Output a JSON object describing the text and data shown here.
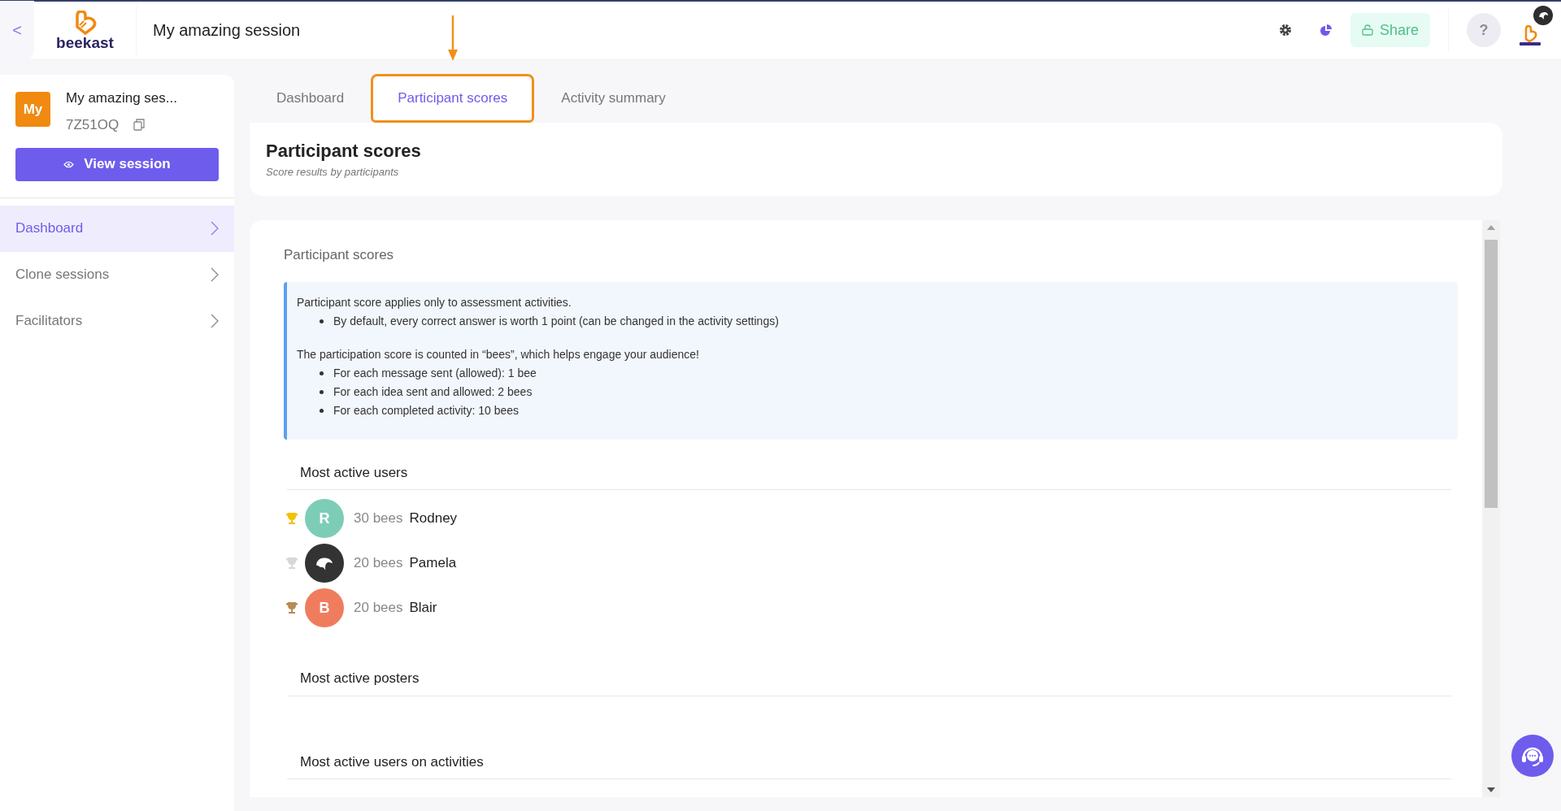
{
  "header": {
    "back": "<",
    "logo": "beekast",
    "title": "My amazing session",
    "share": "Share",
    "help": "?"
  },
  "sidebar": {
    "session": {
      "badge": "My",
      "name": "My amazing ses...",
      "code": "7Z51OQ",
      "view_button": "View session"
    },
    "items": [
      {
        "label": "Dashboard",
        "selected": true
      },
      {
        "label": "Clone sessions",
        "selected": false
      },
      {
        "label": "Facilitators",
        "selected": false
      }
    ]
  },
  "tabs": [
    {
      "label": "Dashboard",
      "selected": false,
      "highlighted": false
    },
    {
      "label": "Participant scores",
      "selected": true,
      "highlighted": true
    },
    {
      "label": "Activity summary",
      "selected": false,
      "highlighted": false
    }
  ],
  "page_header": {
    "title": "Participant scores",
    "subtitle": "Score results by participants"
  },
  "panel": {
    "title": "Participant scores",
    "info": [
      {
        "text": "Participant score applies only to assessment activities.",
        "bullets": [
          "By default, every correct answer is worth 1 point (can be changed in the activity settings)"
        ]
      },
      {
        "text": "The participation score is counted in “bees”, which helps engage your audience!",
        "bullets": [
          "For each message sent (allowed): 1 bee",
          "For each idea sent and allowed: 2 bees",
          "For each completed activity: 10 bees"
        ]
      }
    ],
    "sections": [
      {
        "title": "Most active users",
        "users": [
          {
            "score": "30 bees",
            "name": "Rodney",
            "trophy": {
              "color": "#f2c200"
            },
            "avatar": {
              "kind": "initial",
              "initial": "R",
              "color": "#7dcdb6"
            }
          },
          {
            "score": "20 bees",
            "name": "Pamela",
            "trophy": {
              "color": "#d8d8d8"
            },
            "avatar": {
              "kind": "image",
              "color": "#333333"
            }
          },
          {
            "score": "20 bees",
            "name": "Blair",
            "trophy": {
              "color": "#b98a56"
            },
            "avatar": {
              "kind": "initial",
              "initial": "B",
              "color": "#f07c5e"
            }
          }
        ]
      },
      {
        "title": "Most active posters"
      },
      {
        "title": "Most active users on activities"
      }
    ]
  }
}
